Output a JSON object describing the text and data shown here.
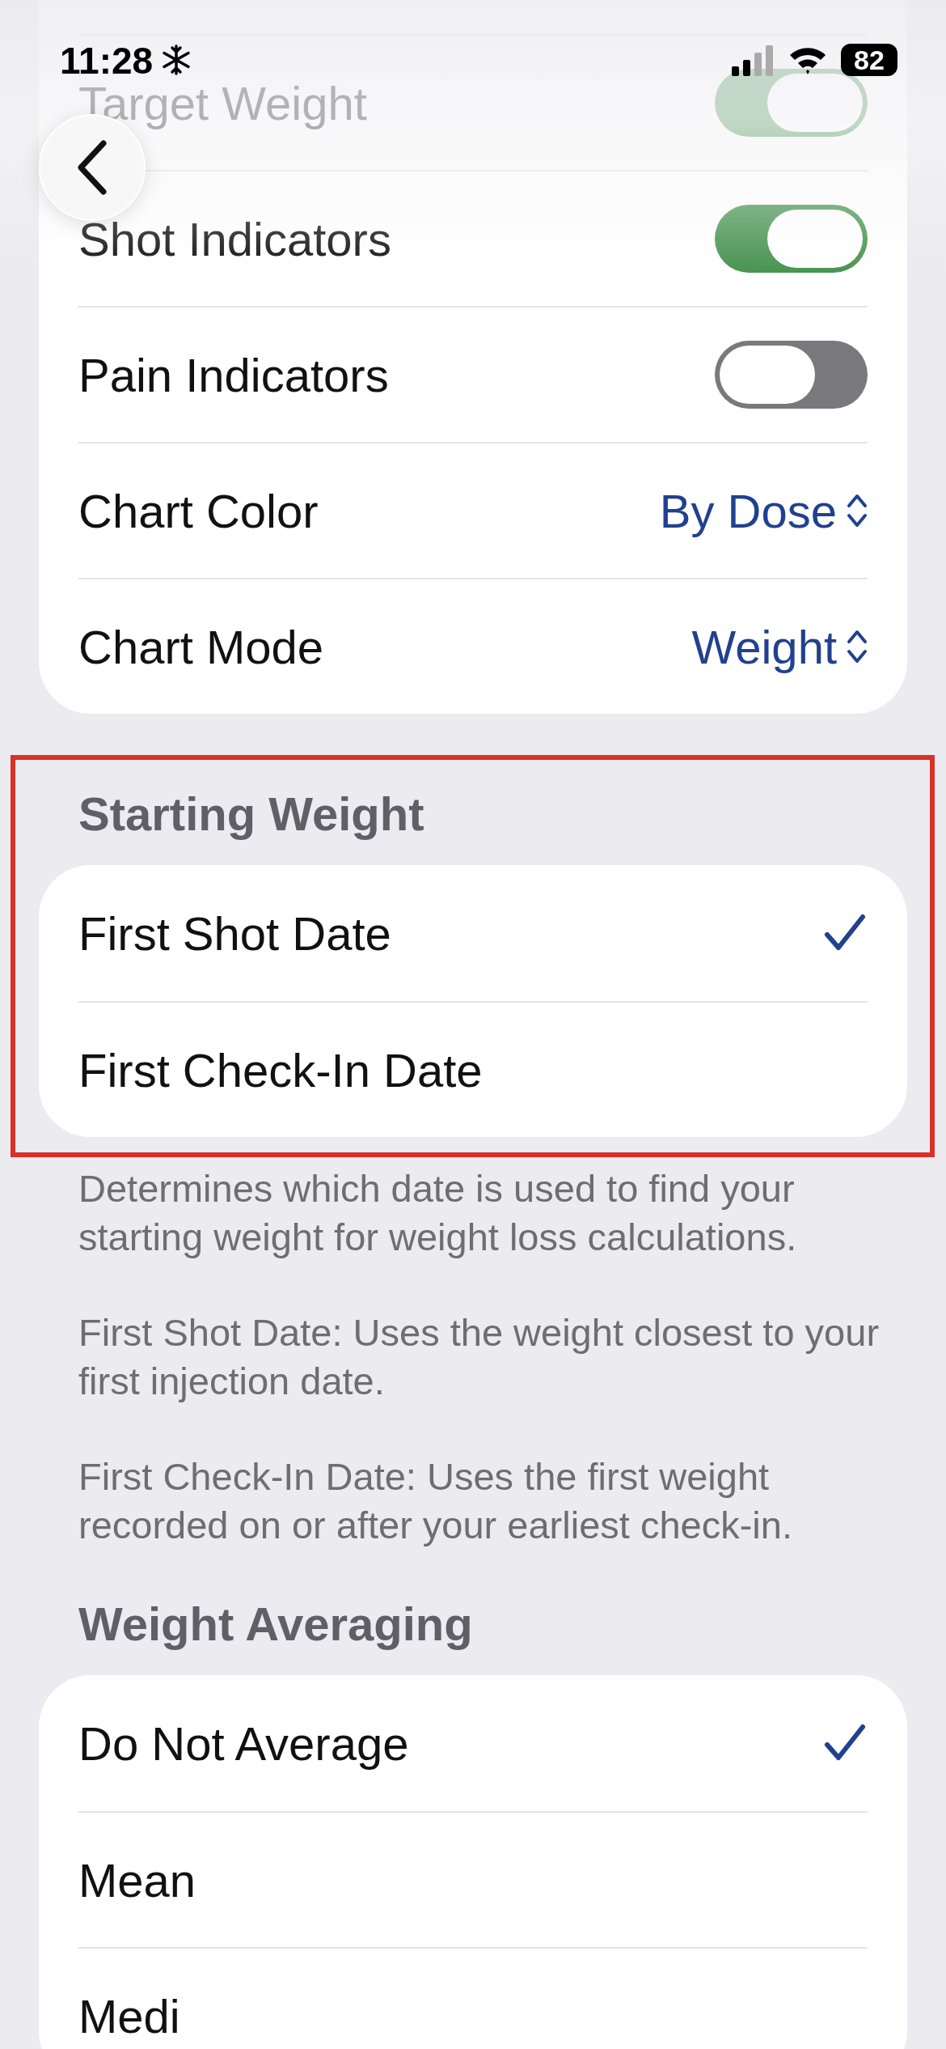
{
  "status_bar": {
    "time": "11:28",
    "battery": "82"
  },
  "display_section": {
    "rows": [
      {
        "kind": "toggle",
        "label": "Target Weight",
        "on": true
      },
      {
        "kind": "toggle",
        "label": "Shot Indicators",
        "on": true
      },
      {
        "kind": "toggle",
        "label": "Pain Indicators",
        "on": false
      },
      {
        "kind": "picker",
        "label": "Chart Color",
        "value": "By Dose"
      },
      {
        "kind": "picker",
        "label": "Chart Mode",
        "value": "Weight"
      }
    ]
  },
  "starting_weight": {
    "header": "Starting Weight",
    "options": [
      {
        "label": "First Shot Date",
        "selected": true
      },
      {
        "label": "First Check-In Date",
        "selected": false
      }
    ],
    "footer": [
      "Determines which date is used to find your starting weight for weight loss calculations.",
      "First Shot Date: Uses the weight closest to your first injection date.",
      "First Check-In Date: Uses the first weight recorded on or after your earliest check-in."
    ]
  },
  "weight_averaging": {
    "header": "Weight Averaging",
    "options": [
      {
        "label": "Do Not Average",
        "selected": true
      },
      {
        "label": "Mean",
        "selected": false
      },
      {
        "label": "Medi",
        "selected": false
      }
    ]
  }
}
